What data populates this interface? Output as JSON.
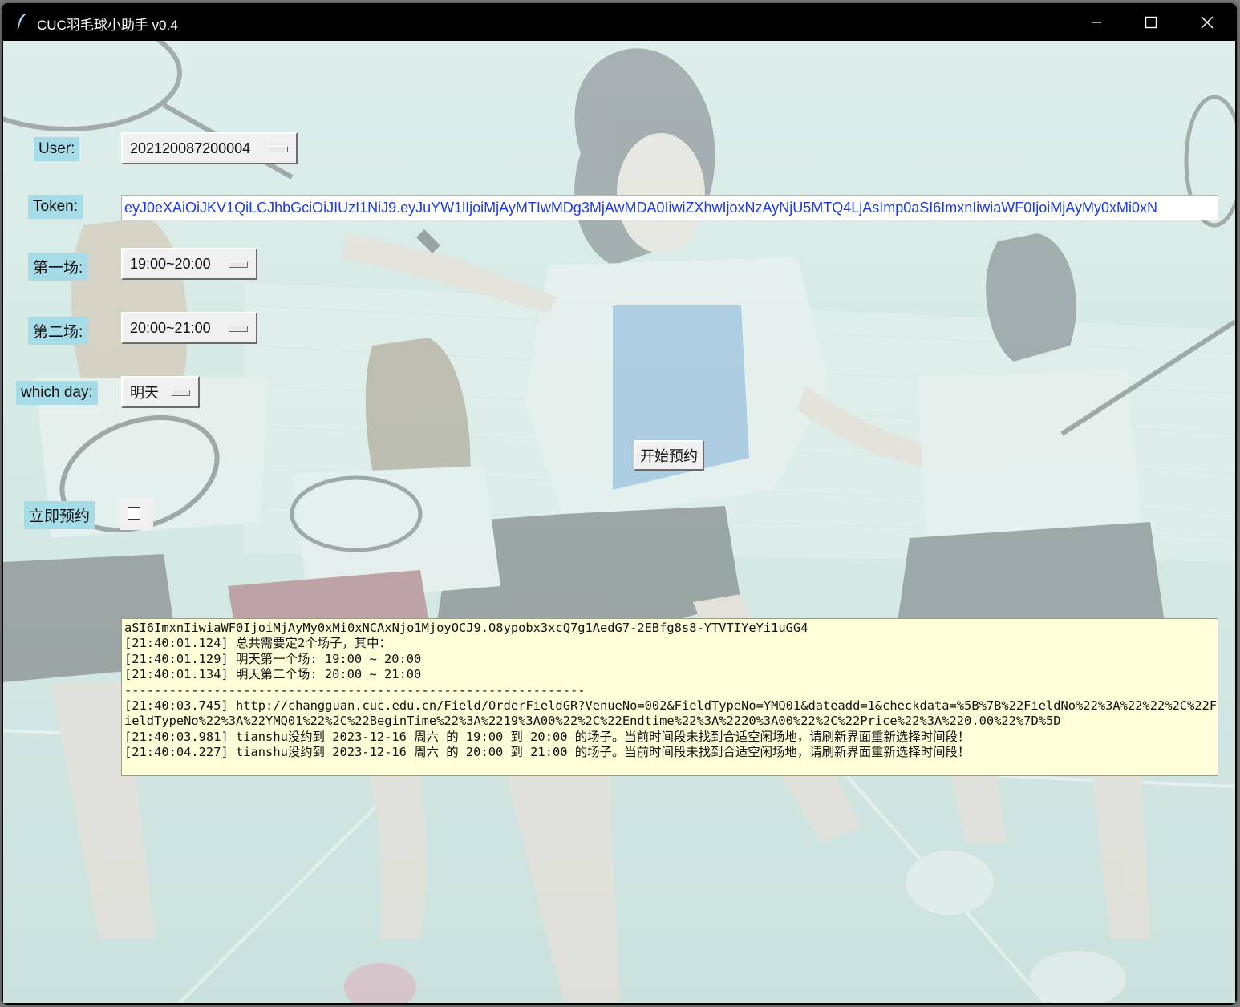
{
  "window": {
    "title": "CUC羽毛球小助手 v0.4",
    "controls": [
      "minimize",
      "maximize",
      "close"
    ]
  },
  "form": {
    "user_label": "User:",
    "user_value": "202120087200004",
    "token_label": "Token:",
    "token_value": "eyJ0eXAiOiJKV1QiLCJhbGciOiJIUzI1NiJ9.eyJuYW1lIjoiMjAyMTIwMDg3MjAwMDA0IiwiZXhwIjoxNzAyNjU5MTQ4LjAsImp0aSI6ImxnIiwiaWF0IjoiMjAyMy0xMi0xN",
    "slot1_label": "第一场:",
    "slot1_value": "19:00~20:00",
    "slot2_label": "第二场:",
    "slot2_value": "20:00~21:00",
    "day_label": "which day:",
    "day_value": "明天",
    "start_button": "开始预约",
    "immediate_label": "立即预约",
    "immediate_checked": false
  },
  "log": {
    "lines": [
      "aSI6ImxnIiwiaWF0IjoiMjAyMy0xMi0xNCAxNjo1MjoyOCJ9.O8ypobx3xcQ7g1AedG7-2EBfg8s8-YTVTIYeYi1uGG4",
      "[21:40:01.124] 总共需要定2个场子，其中：",
      "[21:40:01.129] 明天第一个场: 19:00 ~ 20:00",
      "[21:40:01.134] 明天第二个场: 20:00 ~ 21:00",
      "--------------------------------------------------------------",
      "[21:40:03.745] http://changguan.cuc.edu.cn/Field/OrderFieldGR?VenueNo=002&FieldTypeNo=YMQ01&dateadd=1&checkdata=%5B%7B%22FieldNo%22%3A%22%22%2C%22FieldTypeNo%22%3A%22YMQ01%22%2C%22BeginTime%22%3A%2219%3A00%22%2C%22Endtime%22%3A%2220%3A00%22%2C%22Price%22%3A%220.00%22%7D%5D",
      "[21:40:03.981] tianshu没约到 2023-12-16 周六 的 19:00 到 20:00 的场子。当前时间段未找到合适空闲场地，请刷新界面重新选择时间段！",
      "[21:40:04.227] tianshu没约到 2023-12-16 周六 的 20:00 到 21:00 的场子。当前时间段未找到合适空闲场地，请刷新界面重新选择时间段！"
    ]
  },
  "colors": {
    "label_bg": "#a6dce8",
    "token_text": "#1d3ae8",
    "log_bg": "#ffffd9"
  }
}
